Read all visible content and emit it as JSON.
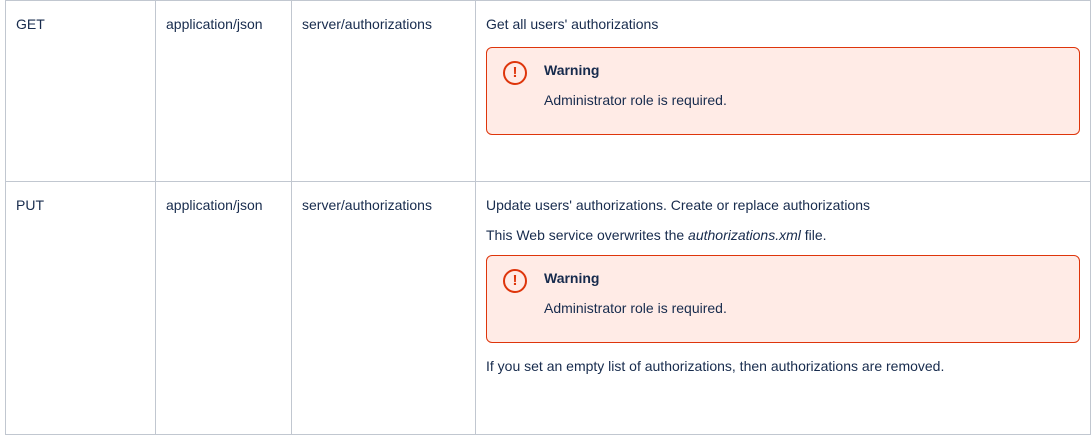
{
  "rows": [
    {
      "method": "GET",
      "content_type": "application/json",
      "path": "server/authorizations",
      "description": "Get all users' authorizations",
      "warning": {
        "icon": "exclamation-circle-icon",
        "title": "Warning",
        "text": "Administrator role is required."
      }
    },
    {
      "method": "PUT",
      "content_type": "application/json",
      "path": "server/authorizations",
      "description": "Update users' authorizations. Create or replace authorizations",
      "note_prefix": "This Web service overwrites the ",
      "note_file": "authorizations.xml",
      "note_suffix": " file.",
      "warning": {
        "icon": "exclamation-circle-icon",
        "title": "Warning",
        "text": "Administrator role is required."
      },
      "footer": "If you set an empty list of authorizations, then authorizations are removed."
    }
  ],
  "colors": {
    "warning_border": "#de350b",
    "warning_background": "#ffebe6",
    "table_border": "#c1c7d0"
  }
}
